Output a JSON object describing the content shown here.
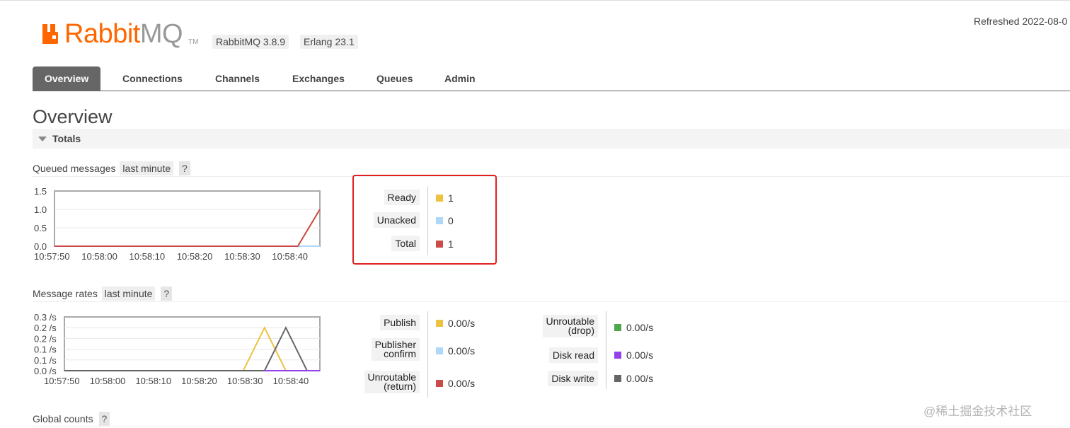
{
  "header": {
    "logo_text_primary": "Rabbit",
    "logo_text_secondary": "MQ",
    "logo_tm": "TM",
    "version_badge": "RabbitMQ 3.8.9",
    "erlang_badge": "Erlang 23.1",
    "refreshed": "Refreshed 2022-08-0"
  },
  "tabs": [
    {
      "label": "Overview",
      "active": true
    },
    {
      "label": "Connections"
    },
    {
      "label": "Channels"
    },
    {
      "label": "Exchanges"
    },
    {
      "label": "Queues"
    },
    {
      "label": "Admin"
    }
  ],
  "page_title": "Overview",
  "section_title": "Totals",
  "queued": {
    "title": "Queued messages",
    "range": "last minute",
    "help": "?",
    "legend": [
      {
        "label": "Ready",
        "value": "1",
        "color": "#edc240"
      },
      {
        "label": "Unacked",
        "value": "0",
        "color": "#afd8f8"
      },
      {
        "label": "Total",
        "value": "1",
        "color": "#cb4b4b"
      }
    ]
  },
  "rates": {
    "title": "Message rates",
    "range": "last minute",
    "help": "?",
    "legend_left": [
      {
        "label": "Publish",
        "value": "0.00/s",
        "color": "#edc240"
      },
      {
        "label1": "Publisher",
        "label2": "confirm",
        "value": "0.00/s",
        "color": "#afd8f8"
      },
      {
        "label1": "Unroutable",
        "label2": "(return)",
        "value": "0.00/s",
        "color": "#cb4b4b"
      }
    ],
    "legend_right": [
      {
        "label1": "Unroutable",
        "label2": "(drop)",
        "value": "0.00/s",
        "color": "#4da74d"
      },
      {
        "label": "Disk read",
        "value": "0.00/s",
        "color": "#9440ed"
      },
      {
        "label": "Disk write",
        "value": "0.00/s",
        "color": "#666666"
      }
    ]
  },
  "global_counts": {
    "title": "Global counts",
    "help": "?"
  },
  "watermark": "@稀土掘金技术社区",
  "chart_data": [
    {
      "type": "line",
      "title": "Queued messages",
      "x": [
        "10:57:50",
        "10:58:00",
        "10:58:10",
        "10:58:20",
        "10:58:30",
        "10:58:40"
      ],
      "ylim": [
        0,
        1.5
      ],
      "y_ticks": [
        "1.5",
        "1.0",
        "0.5",
        "0.0"
      ],
      "series": [
        {
          "name": "Ready",
          "color": "#edc240",
          "points": [
            [
              0,
              0
            ],
            [
              55,
              0
            ],
            [
              60,
              1
            ]
          ]
        },
        {
          "name": "Unacked",
          "color": "#afd8f8",
          "points": [
            [
              0,
              0
            ],
            [
              60,
              0
            ]
          ]
        },
        {
          "name": "Total",
          "color": "#cb4b4b",
          "points": [
            [
              0,
              0
            ],
            [
              55,
              0
            ],
            [
              60,
              1
            ]
          ]
        }
      ]
    },
    {
      "type": "line",
      "title": "Message rates",
      "x": [
        "10:57:50",
        "10:58:00",
        "10:58:10",
        "10:58:20",
        "10:58:30",
        "10:58:40"
      ],
      "ylim": [
        0,
        0.25
      ],
      "y_ticks": [
        "0.3 /s",
        "0.2 /s",
        "0.2 /s",
        "0.1 /s",
        "0.1 /s",
        "0.0 /s"
      ],
      "series": [
        {
          "name": "Publish",
          "color": "#edc240",
          "points": [
            [
              0,
              0
            ],
            [
              42,
              0
            ],
            [
              47,
              0.2
            ],
            [
              52,
              0
            ],
            [
              60,
              0
            ]
          ]
        },
        {
          "name": "Disk write",
          "color": "#666666",
          "points": [
            [
              0,
              0
            ],
            [
              47,
              0
            ],
            [
              52,
              0.2
            ],
            [
              57,
              0
            ],
            [
              60,
              0
            ]
          ]
        },
        {
          "name": "Disk read",
          "color": "#9440ed",
          "points": [
            [
              47,
              0
            ],
            [
              60,
              0
            ]
          ]
        }
      ]
    }
  ]
}
